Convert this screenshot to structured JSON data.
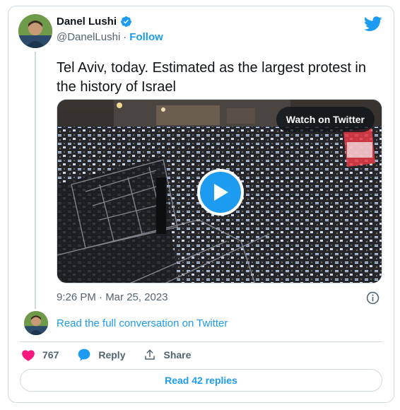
{
  "author": {
    "display_name": "Danel Lushi",
    "handle": "@DanelLushi",
    "separator": "·",
    "follow_label": "Follow"
  },
  "tweet": {
    "text": "Tel Aviv, today. Estimated as the largest protest in the history of Israel",
    "timestamp": "9:26 PM · Mar 25, 2023"
  },
  "media": {
    "watch_label": "Watch on Twitter"
  },
  "thread": {
    "read_conversation_label": "Read the full conversation on Twitter"
  },
  "actions": {
    "like_count": "767",
    "reply_label": "Reply",
    "share_label": "Share"
  },
  "footer": {
    "read_replies_label": "Read 42 replies"
  },
  "colors": {
    "accent": "#1d9bf0",
    "like": "#f91880",
    "text": "#0f1419",
    "secondary": "#536471",
    "border": "#cfd9de"
  },
  "icons": [
    "verified-badge-icon",
    "twitter-bird-icon",
    "play-icon",
    "info-icon",
    "heart-icon",
    "reply-bubble-icon",
    "share-icon"
  ]
}
